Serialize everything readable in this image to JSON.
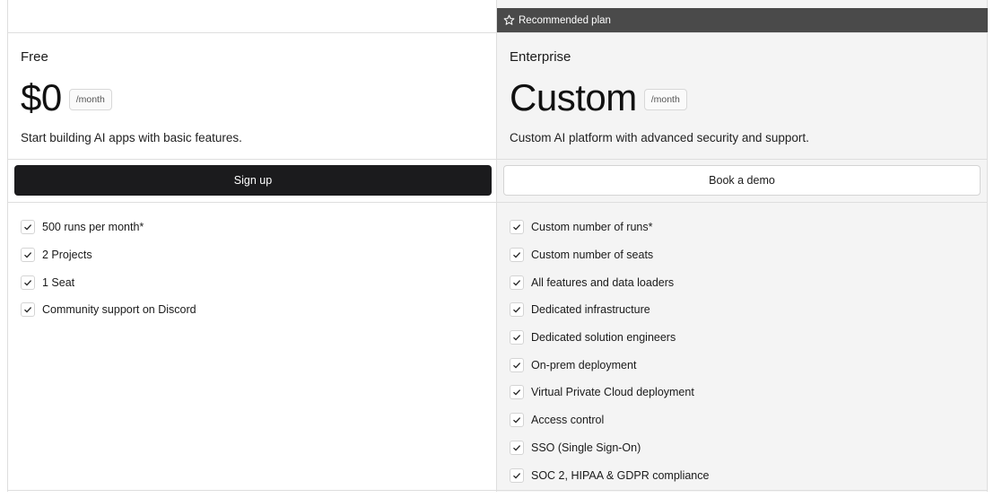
{
  "recommended": {
    "label": "Recommended plan",
    "icon": "star-icon"
  },
  "plans": [
    {
      "name": "Free",
      "price": "$0",
      "period": "/month",
      "description": "Start building AI apps with basic features.",
      "cta": "Sign up",
      "features": [
        "500 runs per month*",
        "2 Projects",
        "1 Seat",
        "Community support on Discord"
      ]
    },
    {
      "name": "Enterprise",
      "price": "Custom",
      "period": "/month",
      "description": "Custom AI platform with advanced security and support.",
      "cta": "Book a demo",
      "features": [
        "Custom number of runs*",
        "Custom number of seats",
        "All features and data loaders",
        "Dedicated infrastructure",
        "Dedicated solution engineers",
        "On-prem deployment",
        "Virtual Private Cloud deployment",
        "Access control",
        "SSO (Single Sign-On)",
        "SOC 2, HIPAA & GDPR compliance"
      ]
    }
  ],
  "colors": {
    "primary_button": "#1b1b1d",
    "recommended_bar": "#4a4a4a",
    "highlight_bg": "#f4f4f4"
  }
}
